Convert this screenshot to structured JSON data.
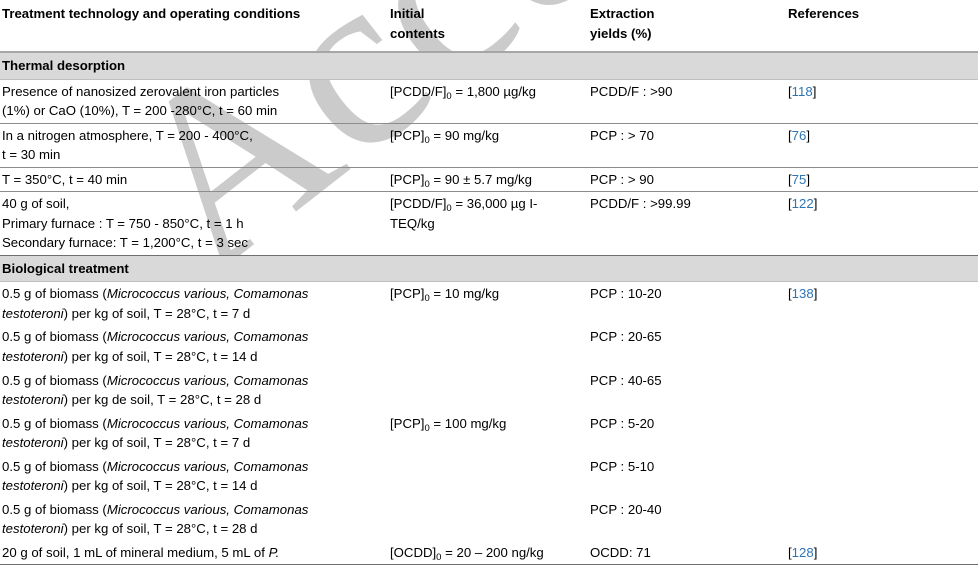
{
  "document": {
    "type": "academic-table",
    "watermark": "Accepted",
    "watermark_color": "#c9c9c9",
    "reference_link_color": "#2e74b5",
    "section_band_color": "#d9d9d9"
  },
  "table": {
    "columns": [
      {
        "id": "treatment",
        "header_lines": [
          "Treatment technology and operating conditions"
        ]
      },
      {
        "id": "initial_contents",
        "header_lines": [
          "Initial",
          "contents"
        ]
      },
      {
        "id": "extraction_yields",
        "header_lines": [
          "Extraction",
          "yields (%)"
        ]
      },
      {
        "id": "references",
        "header_lines": [
          "References"
        ]
      }
    ],
    "sections": [
      {
        "title": "Thermal desorption",
        "rows": [
          {
            "treatment": [
              "Presence of nanosized zerovalent iron particles",
              "(1%) or CaO (10%), T = 200 -280°C, t = 60 min"
            ],
            "initial_contents": [
              "[PCDD/F]₀ = 1,800 µg/kg"
            ],
            "extraction_yields": [
              "PCDD/F : >90"
            ],
            "reference": "[118]",
            "reference_number": "118"
          },
          {
            "treatment": [
              "In a nitrogen atmosphere, T = 200 - 400°C,",
              "t = 30 min"
            ],
            "initial_contents": [
              "[PCP]₀ = 90 mg/kg"
            ],
            "extraction_yields": [
              "PCP : > 70"
            ],
            "reference": "[76]",
            "reference_number": "76"
          },
          {
            "treatment": [
              "T = 350°C, t = 40 min"
            ],
            "initial_contents": [
              "[PCP]₀ = 90 ± 5.7 mg/kg"
            ],
            "extraction_yields": [
              "PCP : > 90"
            ],
            "reference": "[75]",
            "reference_number": "75"
          },
          {
            "treatment": [
              "40 g of soil,",
              "Primary furnace : T = 750 - 850°C, t = 1 h",
              "Secondary furnace: T = 1,200°C, t = 3 sec"
            ],
            "initial_contents": [
              "[PCDD/F]₀ = 36,000 µg I-",
              "TEQ/kg"
            ],
            "extraction_yields": [
              "PCDD/F : >99.99"
            ],
            "reference": "[122]",
            "reference_number": "122"
          }
        ]
      },
      {
        "title": "Biological treatment",
        "rows": [
          {
            "treatment": [
              "0.5 g of biomass (Micrococcus various, Comamonas",
              "testoteroni) per kg of soil, T = 28°C, t = 7 d"
            ],
            "initial_contents": [
              "[PCP]₀ = 10 mg/kg"
            ],
            "extraction_yields": [
              "PCP : 10-20"
            ],
            "reference": "[138]",
            "reference_number": "138"
          },
          {
            "treatment": [
              "0.5 g of biomass (Micrococcus various, Comamonas",
              "testoteroni) per kg of soil, T = 28°C, t = 14 d"
            ],
            "initial_contents": [],
            "extraction_yields": [
              "PCP : 20-65"
            ],
            "reference": "",
            "reference_number": ""
          },
          {
            "treatment": [
              "0.5 g of biomass (Micrococcus various, Comamonas",
              "testoteroni) per kg de soil, T = 28°C, t = 28 d"
            ],
            "initial_contents": [],
            "extraction_yields": [
              "PCP : 40-65"
            ],
            "reference": "",
            "reference_number": ""
          },
          {
            "treatment": [
              "0.5 g of biomass (Micrococcus various, Comamonas",
              "testoteroni) per kg of soil, T = 28°C, t = 7 d"
            ],
            "initial_contents": [
              "[PCP]₀ = 100 mg/kg"
            ],
            "extraction_yields": [
              "PCP : 5-20"
            ],
            "reference": "",
            "reference_number": ""
          },
          {
            "treatment": [
              "0.5 g of biomass (Micrococcus various, Comamonas",
              "testoteroni) per kg of soil, T = 28°C, t = 14 d"
            ],
            "initial_contents": [],
            "extraction_yields": [
              "PCP : 5-10"
            ],
            "reference": "",
            "reference_number": ""
          },
          {
            "treatment": [
              "0.5 g of biomass (Micrococcus various, Comamonas",
              "testoteroni) per kg of soil, T = 28°C, t = 28 d"
            ],
            "initial_contents": [],
            "extraction_yields": [
              "PCP : 20-40"
            ],
            "reference": "",
            "reference_number": ""
          },
          {
            "treatment": [
              "20 g of soil, 1 mL of mineral medium, 5 mL of P."
            ],
            "initial_contents": [
              "[OCDD]₀ = 20 – 200 ng/kg"
            ],
            "extraction_yields": [
              "OCDD: 71"
            ],
            "reference": "[128]",
            "reference_number": "128"
          }
        ]
      }
    ]
  }
}
